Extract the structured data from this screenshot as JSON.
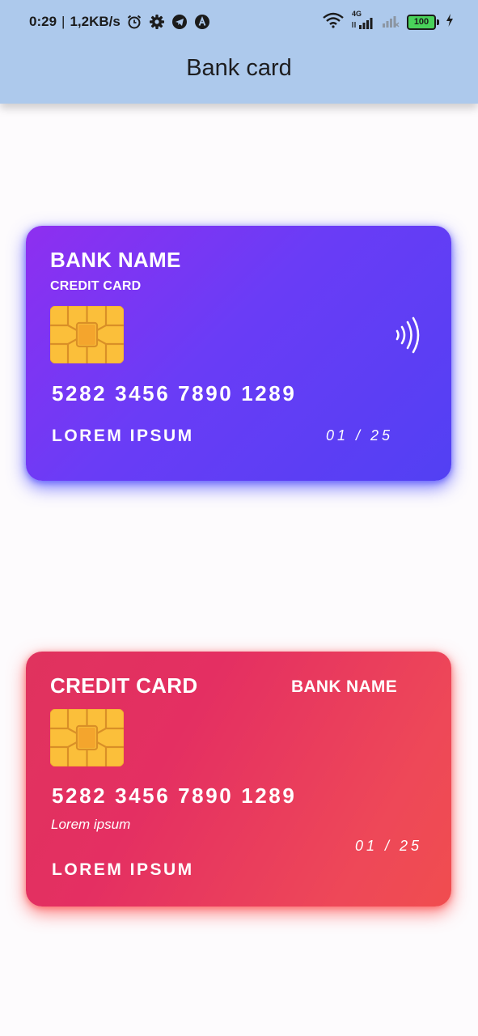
{
  "status_bar": {
    "time": "0:29",
    "separator": "|",
    "net_speed": "1,2KB/s",
    "network_type": "4G",
    "battery_level": "100",
    "icons_left": [
      "alarm-icon",
      "settings-gear-icon",
      "telegram-icon",
      "app-icon"
    ],
    "icons_right": [
      "wifi-icon",
      "signal-4g-icon",
      "signal-no-service-icon",
      "battery-icon",
      "charging-icon"
    ]
  },
  "app_bar": {
    "title": "Bank card",
    "background": "#adc9ec"
  },
  "cards": [
    {
      "bank_name": "BANK NAME",
      "card_type": "CREDIT CARD",
      "number": "5282 3456 7890 1289",
      "holder": "LOREM IPSUM",
      "expiry": "01 / 25",
      "gradient": [
        "#8e2ff0",
        "#5240f3"
      ],
      "glow": "#5050ff",
      "icons": [
        "chip-icon",
        "contactless-icon"
      ]
    },
    {
      "card_type": "CREDIT CARD",
      "bank_name": "BANK NAME",
      "number": "5282 3456 7890 1289",
      "subtitle": "Lorem ipsum",
      "expiry": "01 / 25",
      "holder": "LOREM IPSUM",
      "gradient": [
        "#e0335e",
        "#f04d4f"
      ],
      "glow": "#ff5050",
      "icons": [
        "chip-icon"
      ]
    }
  ]
}
